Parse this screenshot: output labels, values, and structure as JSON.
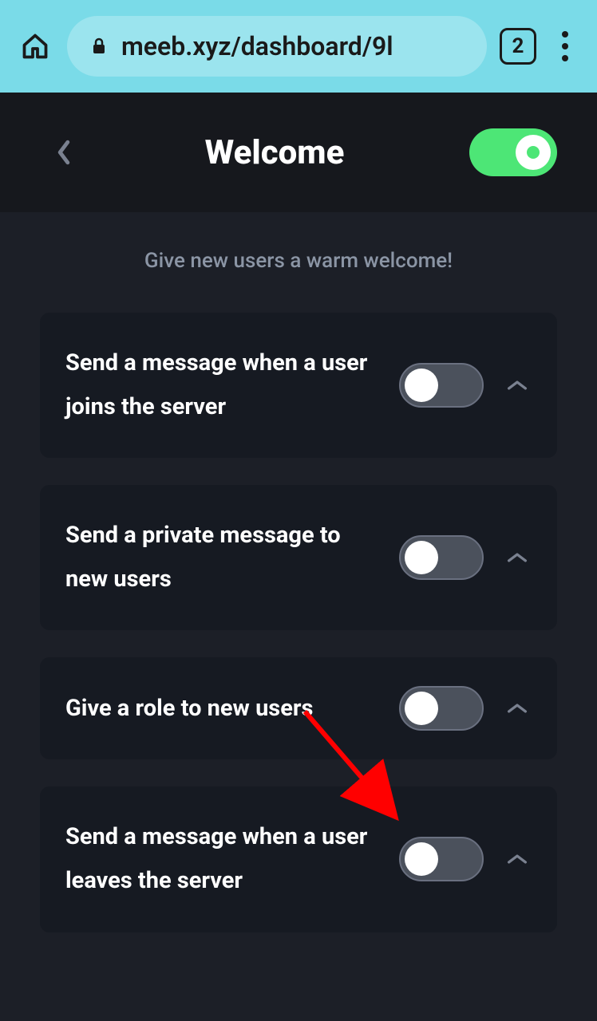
{
  "browser": {
    "url": "meeb.xyz/dashboard/9l",
    "tab_count": "2"
  },
  "header": {
    "title": "Welcome"
  },
  "subtitle": "Give new users a warm welcome!",
  "cards": [
    {
      "label": "Send a message when a user joins the server"
    },
    {
      "label": "Send a private message to new users"
    },
    {
      "label": "Give a role to new users"
    },
    {
      "label": "Send a message when a user leaves the server"
    }
  ]
}
